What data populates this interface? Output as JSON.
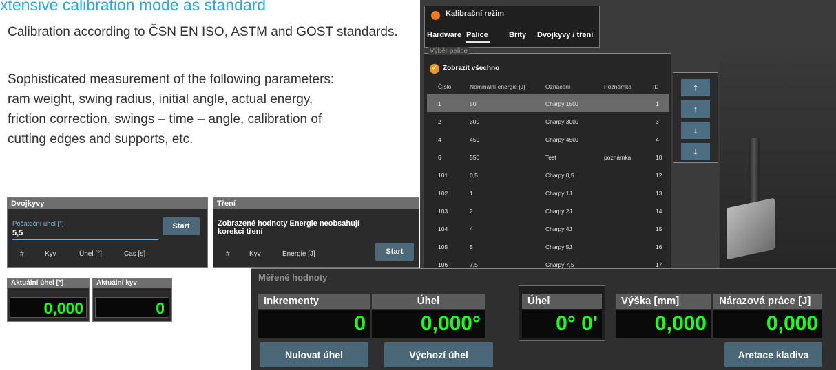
{
  "heading": "xtensive calibration mode as standard",
  "paragraphs": [
    "Calibration according to ČSN EN ISO, ASTM and GOST standards.",
    "Sophisticated measurement of the following parameters: ram weight, swing radius, initial angle, actual energy, friction correction, swings – time – angle, calibration of cutting edges and supports, etc."
  ],
  "calibration_window": {
    "title": "Kalibrační režim",
    "tabs": [
      "Hardware",
      "Palice",
      "Břity",
      "Dvojkyvy / tření"
    ],
    "active_tab": "Palice",
    "panel_legend": "Výběr palice",
    "show_all": "Zobrazit všechno",
    "columns": [
      "Číslo",
      "Nominální energie [J]",
      "Označení",
      "Poznámka",
      "ID"
    ],
    "rows": [
      {
        "cislo": "1",
        "energie": "50",
        "oznaceni": "Charpy 150J",
        "poznamka": "",
        "id": "1",
        "selected": true
      },
      {
        "cislo": "2",
        "energie": "300",
        "oznaceni": "Charpy 300J",
        "poznamka": "",
        "id": "3"
      },
      {
        "cislo": "4",
        "energie": "450",
        "oznaceni": "Charpy 450J",
        "poznamka": "",
        "id": "4"
      },
      {
        "cislo": "6",
        "energie": "550",
        "oznaceni": "Test",
        "poznamka": "poznámka",
        "id": "10"
      },
      {
        "cislo": "101",
        "energie": "0,5",
        "oznaceni": "Charpy 0,5",
        "poznamka": "",
        "id": "12"
      },
      {
        "cislo": "102",
        "energie": "1",
        "oznaceni": "Charpy 1J",
        "poznamka": "",
        "id": "13"
      },
      {
        "cislo": "103",
        "energie": "2",
        "oznaceni": "Charpy 2J",
        "poznamka": "",
        "id": "14"
      },
      {
        "cislo": "104",
        "energie": "4",
        "oznaceni": "Charpy 4J",
        "poznamka": "",
        "id": "15"
      },
      {
        "cislo": "105",
        "energie": "5",
        "oznaceni": "Charpy 5J",
        "poznamka": "",
        "id": "16"
      },
      {
        "cislo": "106",
        "energie": "7,5",
        "oznaceni": "Charpy 7,5",
        "poznamka": "",
        "id": "17"
      }
    ],
    "order_buttons": [
      "⤒",
      "↑",
      "↓",
      "⤓"
    ]
  },
  "dvojkyvy": {
    "title": "Dvojkyvy",
    "initial_angle_label": "Počáteční úhel [°]",
    "initial_angle_value": "5,5",
    "start": "Start",
    "columns": [
      "#",
      "Kyv",
      "Úhel [°]",
      "Čas [s]"
    ]
  },
  "treni": {
    "title": "Tření",
    "message": "Zobrazené hodnoty Energie neobsahují korekci tření",
    "columns": [
      "#",
      "Kyv",
      "Energie [J]"
    ],
    "start": "Start"
  },
  "current": {
    "angle_label": "Aktuální úhel [°]",
    "angle_value": "0,000",
    "swing_label": "Aktuální kyv",
    "swing_value": "0"
  },
  "measured": {
    "legend": "Měřené hodnoty",
    "increments_label": "Inkrementy",
    "increments_value": "0",
    "angle_label": "Úhel",
    "angle_value": "0,000°",
    "angle2_label": "Úhel",
    "angle2_value": "0° 0'",
    "height_label": "Výška [mm]",
    "height_value": "0,000",
    "impact_label": "Nárazová práce [J]",
    "impact_value": "0,000",
    "reset_angle": "Nulovat úhel",
    "default_angle": "Výchozí úhel",
    "lock_hammer": "Aretace kladiva"
  },
  "colors": {
    "accent_blue": "#29a7df",
    "value_green": "#16ff16",
    "title_dot_orange": "#f07a1c"
  }
}
